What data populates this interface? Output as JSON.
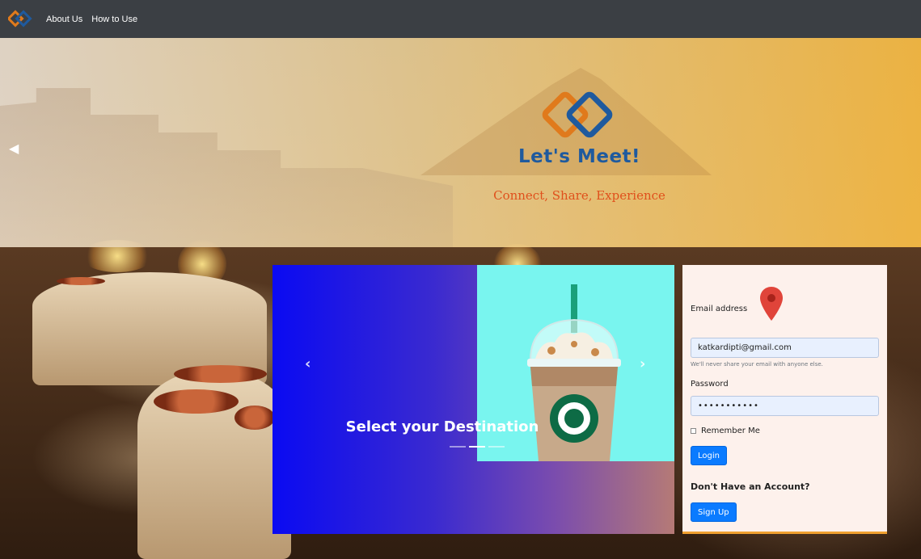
{
  "navbar": {
    "links": [
      "About Us",
      "How to Use"
    ]
  },
  "hero": {
    "title": "Let's Meet!",
    "tagline": "Connect, Share, Experience"
  },
  "carousel": {
    "caption": "Select your Destination",
    "indicator_count": 3,
    "active_indicator": 1
  },
  "login": {
    "email_label": "Email address",
    "email_value": "katkardipti@gmail.com",
    "email_help": "We'll never share your email with anyone else.",
    "password_label": "Password",
    "password_value": "•••••••••••",
    "remember_label": "Remember Me",
    "login_button": "Login",
    "no_account_text": "Don't Have an Account?",
    "signup_button": "Sign Up"
  },
  "colors": {
    "navbar_bg": "#3b3f44",
    "brand_blue": "#1f5a9e",
    "brand_orange": "#e07a1c",
    "tagline": "#e0501c",
    "button_primary": "#0a7bff"
  }
}
